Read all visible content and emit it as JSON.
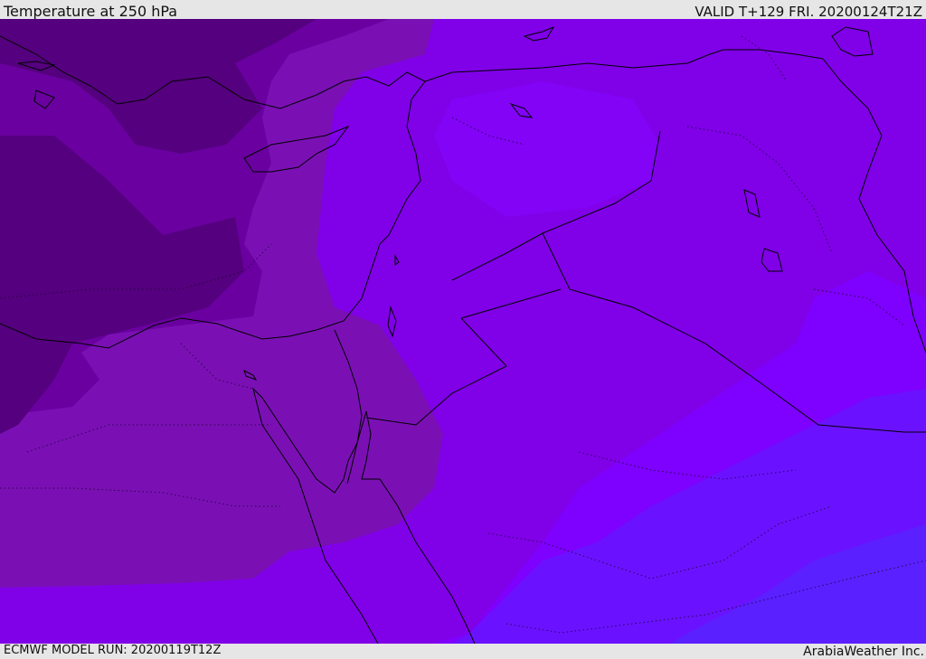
{
  "header": {
    "title": "Temperature at 250 hPa",
    "valid": "VALID T+129 FRI. 20200124T21Z"
  },
  "footer": {
    "model_run": "ECMWF MODEL RUN: 20200119T12Z",
    "credit": "ArabiaWeather Inc."
  },
  "colors": {
    "band_darkest": "#55007f",
    "band_dark": "#6a00a0",
    "band_mid": "#7a10b4",
    "band_violet": "#8000e8",
    "band_bright": "#7e00ff",
    "band_blue_violet": "#6a12ff",
    "band_blue": "#5a20ff",
    "coastline": "#000000",
    "header_bg": "#e6e6e6"
  }
}
